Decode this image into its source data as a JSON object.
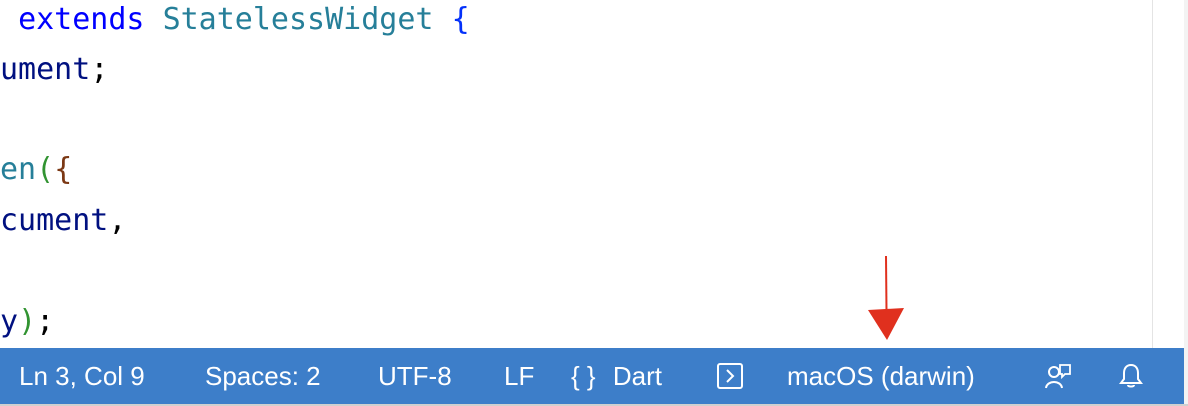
{
  "editor": {
    "lines": [
      {
        "indent": " ",
        "keyword": "extends",
        "type": "StatelessWidget",
        "brace": "{"
      },
      {
        "var": "ument",
        "punc": ";"
      },
      {
        "fn": "en",
        "paren": "(",
        "brace": "{"
      },
      {
        "var": "cument",
        "punc": ","
      },
      {
        "var": "y",
        "paren": ")",
        "punc": ";"
      }
    ]
  },
  "statusbar": {
    "cursor_position": "Ln 3, Col 9",
    "indentation": "Spaces: 2",
    "encoding": "UTF-8",
    "line_ending": "LF",
    "language_icon": "{ }",
    "language": "Dart",
    "device_icon": "terminal-box-icon",
    "device": "macOS (darwin)",
    "feedback_icon": "feedback-person-icon",
    "notifications_icon": "bell-icon",
    "background_color": "#3d7ec9"
  },
  "annotation": {
    "arrow_color": "#e0301e"
  }
}
